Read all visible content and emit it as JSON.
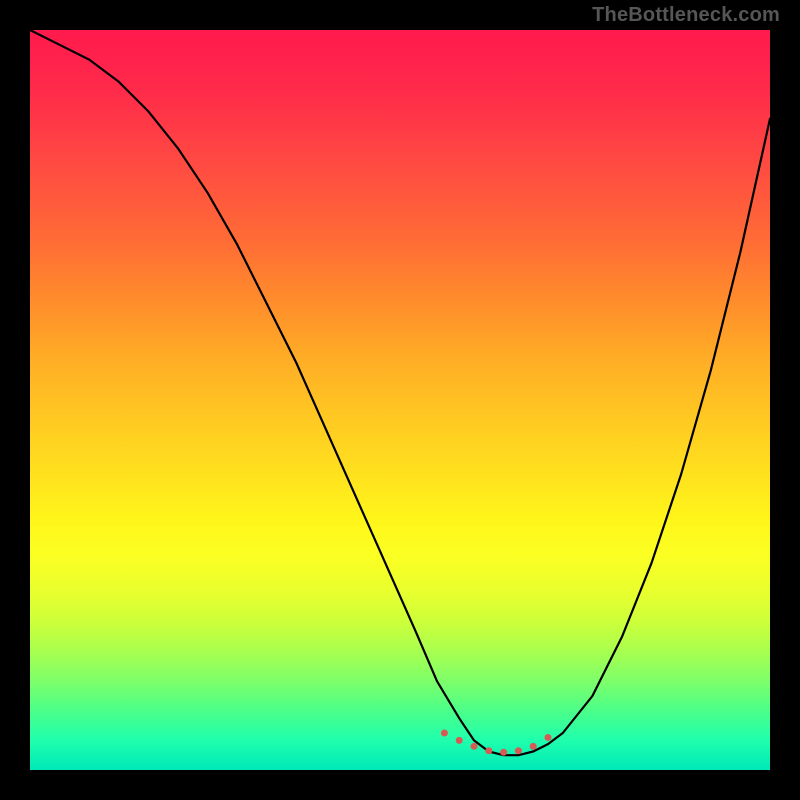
{
  "watermark": "TheBottleneck.com",
  "chart_data": {
    "type": "line",
    "title": "",
    "xlabel": "",
    "ylabel": "",
    "xlim": [
      0,
      100
    ],
    "ylim": [
      0,
      100
    ],
    "grid": false,
    "legend": false,
    "series": [
      {
        "name": "curve",
        "x": [
          0,
          4,
          8,
          12,
          16,
          20,
          24,
          28,
          32,
          36,
          40,
          44,
          48,
          52,
          55,
          58,
          60,
          62,
          64,
          66,
          68,
          70,
          72,
          76,
          80,
          84,
          88,
          92,
          96,
          100
        ],
        "y": [
          100,
          98,
          96,
          93,
          89,
          84,
          78,
          71,
          63,
          55,
          46,
          37,
          28,
          19,
          12,
          7,
          4,
          2.5,
          2,
          2,
          2.5,
          3.5,
          5,
          10,
          18,
          28,
          40,
          54,
          70,
          88
        ]
      }
    ],
    "marker_series": {
      "name": "flat-bottom-dots",
      "x": [
        56,
        58,
        60,
        62,
        64,
        66,
        68,
        70
      ],
      "y": [
        5.0,
        4.0,
        3.2,
        2.6,
        2.4,
        2.6,
        3.2,
        4.4
      ],
      "color": "#d95a55",
      "radius": 3.5
    },
    "background_gradient_stops": [
      {
        "pos": 0.0,
        "color": "#ff1a4d"
      },
      {
        "pos": 0.18,
        "color": "#ff4a42"
      },
      {
        "pos": 0.36,
        "color": "#ff8a2c"
      },
      {
        "pos": 0.52,
        "color": "#ffc722"
      },
      {
        "pos": 0.66,
        "color": "#fff51a"
      },
      {
        "pos": 0.8,
        "color": "#ccff3a"
      },
      {
        "pos": 0.92,
        "color": "#4bff89"
      },
      {
        "pos": 1.0,
        "color": "#00e8b8"
      }
    ]
  }
}
